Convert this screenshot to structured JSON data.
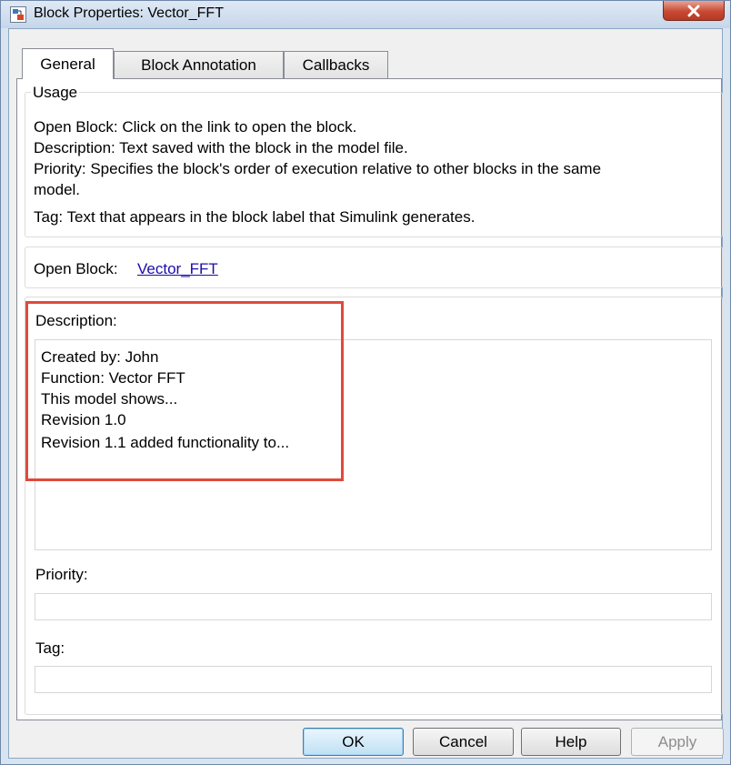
{
  "window": {
    "title": "Block Properties: Vector_FFT",
    "close_glyph": "X"
  },
  "tabs": [
    {
      "label": "General",
      "active": true
    },
    {
      "label": "Block Annotation",
      "active": false
    },
    {
      "label": "Callbacks",
      "active": false
    }
  ],
  "usage": {
    "title": "Usage",
    "lines": [
      "Open Block: Click on the link to open the block.",
      "Description: Text saved with the block in the model file.",
      "Priority: Specifies the block's order of execution relative to other blocks in the same",
      "model.",
      "Tag: Text that appears in the block label that Simulink generates."
    ]
  },
  "open_block": {
    "label": "Open Block:",
    "link_text": "Vector_FFT"
  },
  "description": {
    "label": "Description:",
    "lines": [
      "Created by: John",
      "Function: Vector FFT",
      "This model shows...",
      "Revision 1.0",
      "Revision 1.1 added functionality to..."
    ]
  },
  "priority": {
    "label": "Priority:",
    "value": ""
  },
  "tag": {
    "label": "Tag:",
    "value": ""
  },
  "buttons": {
    "ok": "OK",
    "cancel": "Cancel",
    "help": "Help",
    "apply": "Apply"
  },
  "colors": {
    "highlight": "#e04a3b",
    "link": "#1a0dab",
    "close_button": "#c84a33"
  }
}
